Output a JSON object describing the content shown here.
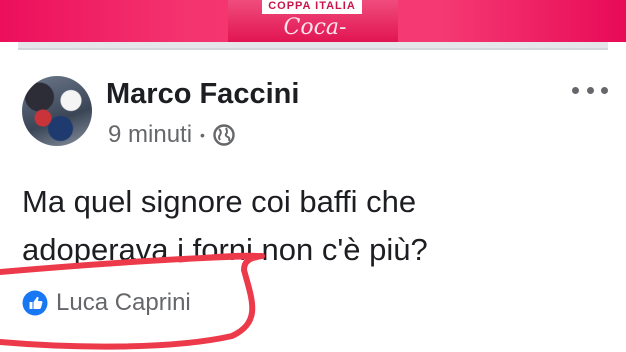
{
  "banner": {
    "top_text": "COPPA ITALIA",
    "logo_text": "Coca-Cola"
  },
  "post": {
    "author": "Marco Faccini",
    "time": "9 minuti",
    "separator": "•",
    "text_line1": "Ma quel signore coi baffi che",
    "text_line2": "adoperava i forni non c'è  più?",
    "reaction_name": "Luca Caprini"
  },
  "icons": {
    "privacy": "globe-icon",
    "menu": "more-options-icon",
    "reaction": "like-icon"
  },
  "colors": {
    "banner": "#ec0f5c",
    "like_blue": "#1877f2",
    "scribble": "#ec3a4a",
    "secondary_text": "#65676b"
  }
}
